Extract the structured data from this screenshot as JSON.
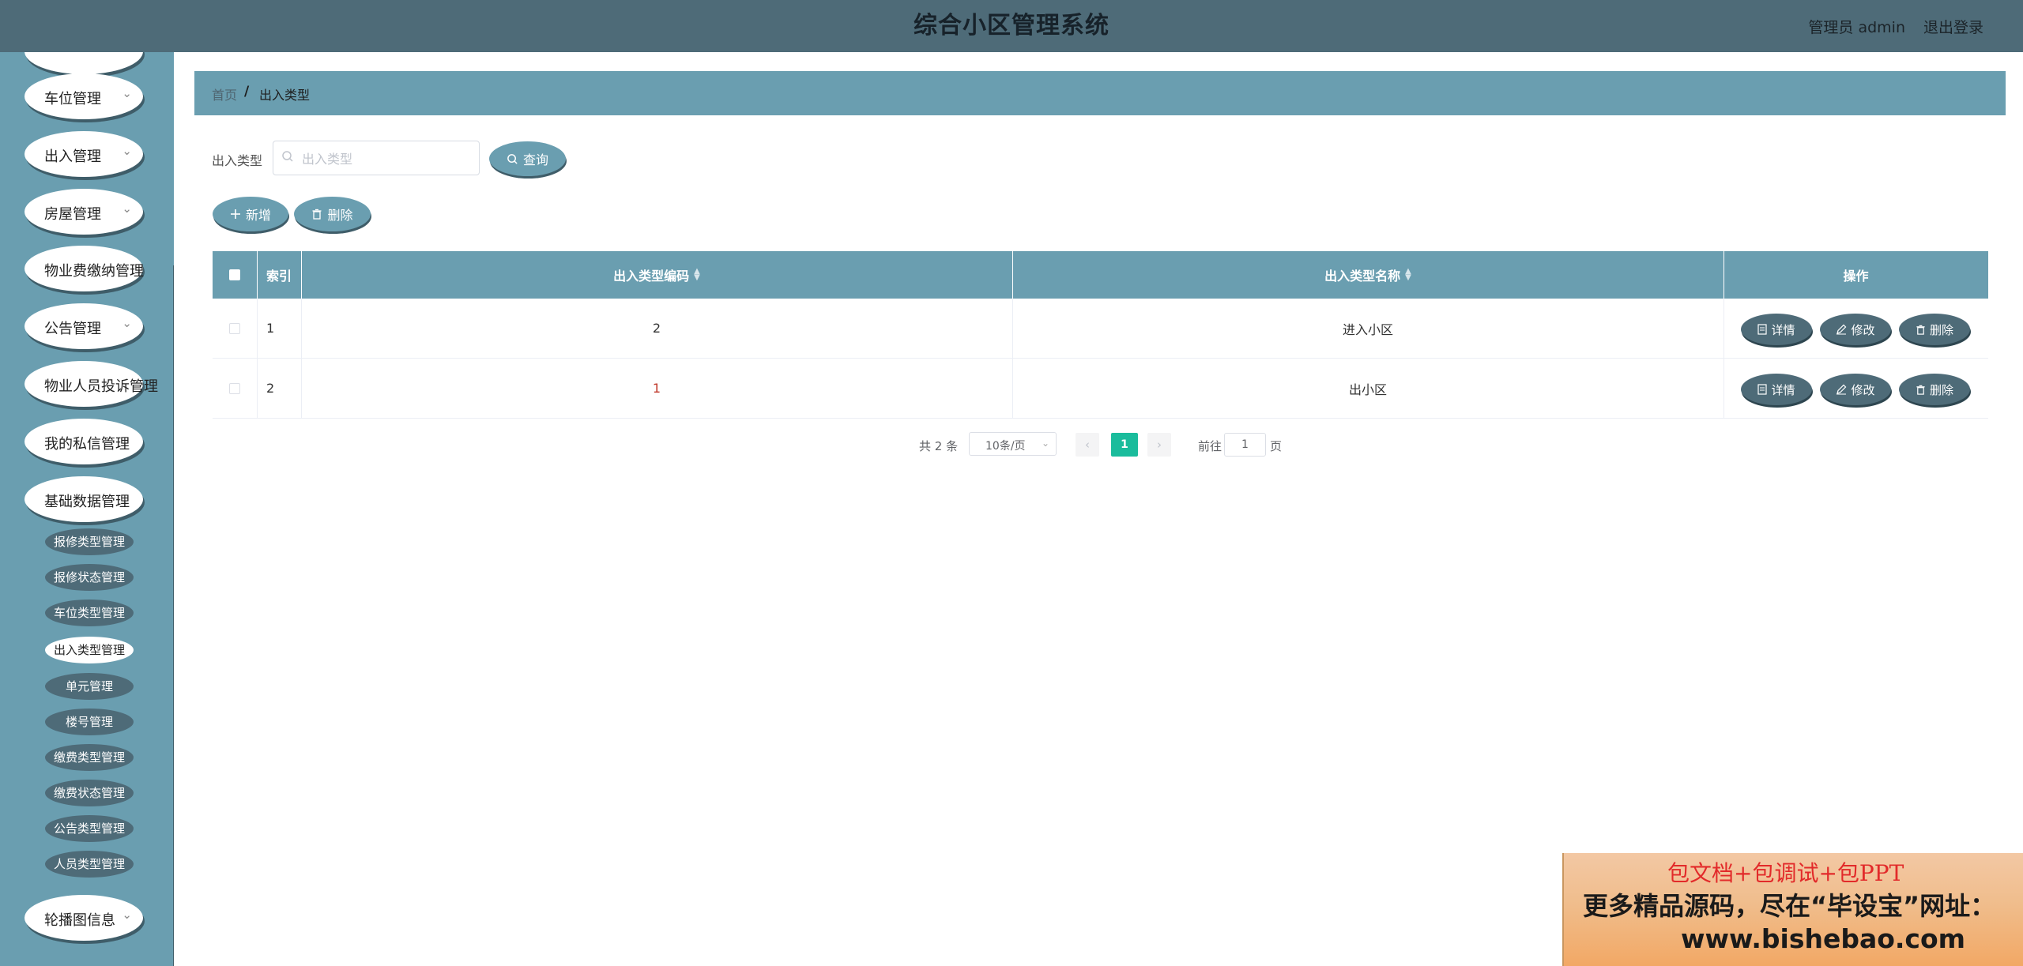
{
  "header": {
    "title": "综合小区管理系统",
    "user_label": "管理员 admin",
    "logout_label": "退出登录"
  },
  "sidebar": {
    "menus": [
      {
        "label": "车位管理"
      },
      {
        "label": "出入管理"
      },
      {
        "label": "房屋管理"
      },
      {
        "label": "物业费缴纳管理"
      },
      {
        "label": "公告管理"
      },
      {
        "label": "物业人员投诉管理"
      },
      {
        "label": "我的私信管理"
      },
      {
        "label": "基础数据管理"
      },
      {
        "label": "轮播图信息"
      }
    ],
    "submenu": [
      {
        "label": "报修类型管理"
      },
      {
        "label": "报修状态管理"
      },
      {
        "label": "车位类型管理"
      },
      {
        "label": "出入类型管理"
      },
      {
        "label": "单元管理"
      },
      {
        "label": "楼号管理"
      },
      {
        "label": "缴费类型管理"
      },
      {
        "label": "缴费状态管理"
      },
      {
        "label": "公告类型管理"
      },
      {
        "label": "人员类型管理"
      }
    ],
    "active_submenu": "出入类型管理"
  },
  "breadcrumb": {
    "home": "首页",
    "separator": "/",
    "current": "出入类型"
  },
  "search": {
    "label": "出入类型",
    "placeholder": "出入类型",
    "value": "",
    "query_button": "查询"
  },
  "actions": {
    "add": "新增",
    "delete": "删除"
  },
  "table": {
    "columns": {
      "index": "索引",
      "code": "出入类型编码",
      "name": "出入类型名称",
      "ops": "操作"
    },
    "rows": [
      {
        "index": "1",
        "code": "2",
        "name": "进入小区"
      },
      {
        "index": "2",
        "code": "1",
        "name": "出小区"
      }
    ],
    "row_actions": {
      "detail": "详情",
      "edit": "修改",
      "delete": "删除"
    }
  },
  "pagination": {
    "total": "共 2 条",
    "page_size": "10条/页",
    "current_page": "1",
    "goto_label": "前往",
    "goto_value": "1",
    "page_suffix": "页"
  },
  "promo": {
    "line1": "包文档+包调试+包PPT",
    "line2": "更多精品源码，尽在“毕设宝”网址：",
    "line3": "www.bishebao.com"
  },
  "colors": {
    "header_bg": "#4e6b78",
    "sidebar_bg": "#6a9eb0",
    "accent_dark": "#4e6b78",
    "active_page": "#1abc9c"
  }
}
